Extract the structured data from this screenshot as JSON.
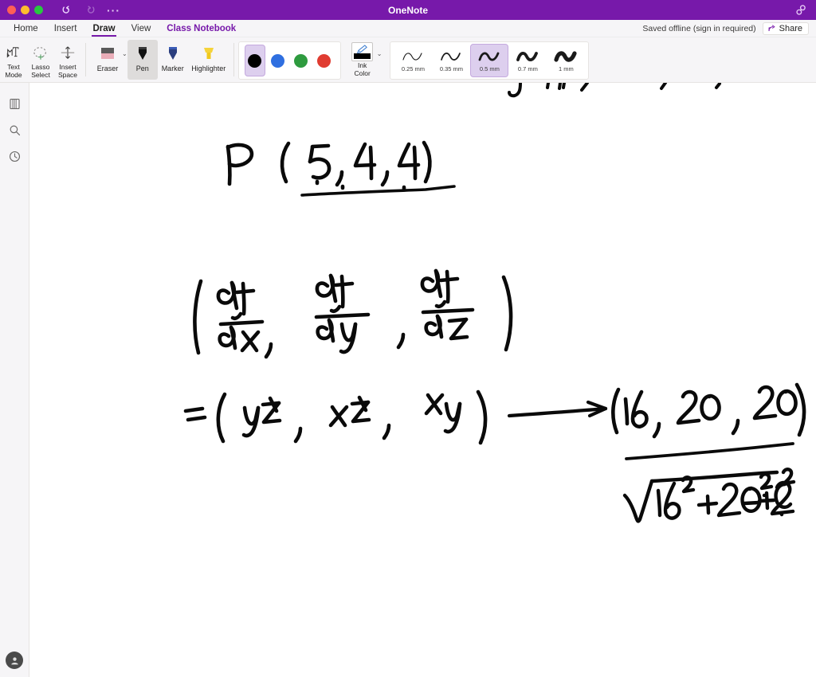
{
  "window": {
    "app_title": "OneNote",
    "traffic_lights": [
      "close-red",
      "minimize-yellow",
      "maximize-green"
    ],
    "undo_icon": "undo-arrow-icon",
    "redo_icon": "redo-arrow-icon",
    "overflow_icon": "more-options-icon",
    "link_icon": "link-chain-icon",
    "titlebar_color": "#7719aa"
  },
  "menubar": {
    "tabs": [
      {
        "label": "Home",
        "active": false,
        "accent": false
      },
      {
        "label": "Insert",
        "active": false,
        "accent": false
      },
      {
        "label": "Draw",
        "active": true,
        "accent": false
      },
      {
        "label": "View",
        "active": false,
        "accent": false
      },
      {
        "label": "Class Notebook",
        "active": false,
        "accent": true
      }
    ],
    "status_text": "Saved offline (sign in required)",
    "share_label": "Share",
    "share_icon": "share-arrow-icon",
    "accent_color": "#7719aa"
  },
  "ribbon": {
    "mode_buttons": [
      {
        "label_line1": "Text",
        "label_line2": "Mode",
        "icon": "text-mode-icon"
      },
      {
        "label_line1": "Lasso",
        "label_line2": "Select",
        "icon": "lasso-select-icon"
      },
      {
        "label_line1": "Insert",
        "label_line2": "Space",
        "icon": "insert-space-icon"
      }
    ],
    "tools": [
      {
        "label": "Eraser",
        "icon": "eraser-icon",
        "selected": false,
        "has_dropdown": true
      },
      {
        "label": "Pen",
        "icon": "pen-icon",
        "selected": true,
        "has_dropdown": false
      },
      {
        "label": "Marker",
        "icon": "marker-icon",
        "selected": false,
        "has_dropdown": false
      },
      {
        "label": "Highlighter",
        "icon": "highlighter-icon",
        "selected": false,
        "has_dropdown": false
      }
    ],
    "colors": [
      {
        "name": "black",
        "hex": "#000000",
        "selected": true
      },
      {
        "name": "blue",
        "hex": "#2f6fe0",
        "selected": false
      },
      {
        "name": "green",
        "hex": "#2e9b3f",
        "selected": false
      },
      {
        "name": "red",
        "hex": "#e03c31",
        "selected": false
      }
    ],
    "ink_color": {
      "label_line1": "Ink",
      "label_line2": "Color",
      "icon": "ink-color-icon",
      "current_hex": "#000000",
      "dropdown_icon": "chevron-down-icon"
    },
    "thicknesses": [
      {
        "label": "0.25 mm",
        "stroke": 1.1,
        "selected": false
      },
      {
        "label": "0.35 mm",
        "stroke": 1.7,
        "selected": false
      },
      {
        "label": "0.5 mm",
        "stroke": 2.8,
        "selected": true
      },
      {
        "label": "0.7 mm",
        "stroke": 3.8,
        "selected": false
      },
      {
        "label": "1 mm",
        "stroke": 5.2,
        "selected": false
      }
    ],
    "selection_highlight_color": "#ddcfee"
  },
  "rail": {
    "items": [
      {
        "name": "notebooks-icon"
      },
      {
        "name": "search-icon"
      },
      {
        "name": "recent-icon"
      }
    ],
    "avatar_icon": "user-avatar-icon"
  },
  "canvas": {
    "ink_color": "#0a0a0a",
    "notes": [
      {
        "id": "top-cutoff",
        "text": "(partial cut-off strokes)"
      },
      {
        "id": "point-p",
        "text": "P (5, 4, 4)"
      },
      {
        "id": "gradient",
        "text": "( ∂f/∂x , ∂f/∂y , ∂f/∂z )"
      },
      {
        "id": "partials",
        "text": "= ( yz , xz , xy )"
      },
      {
        "id": "arrow",
        "text": "⟶"
      },
      {
        "id": "evaluated",
        "text": "(16, 20, 20)"
      },
      {
        "id": "denominator",
        "text": "√(16² + 20² + 20²)"
      }
    ]
  }
}
